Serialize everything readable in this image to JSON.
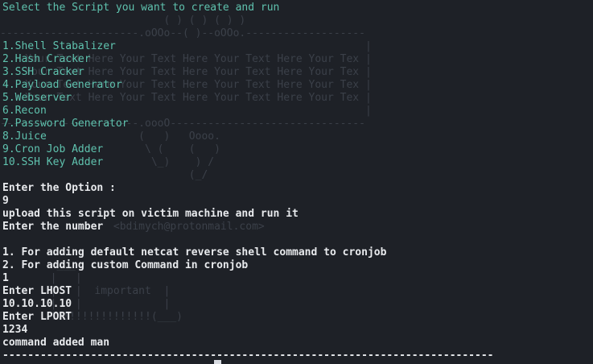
{
  "terminal": {
    "header": "Select the Script you want to create and run",
    "menu": [
      "1.Shell Stabalizer",
      "2.Hash Cracker",
      "3.SSH Cracker",
      "4.Payload Generator",
      "5.Webserver",
      "6.Recon",
      "7.Password Generator",
      "8.Juice",
      "9.Cron Job Adder",
      "10.SSH Key Adder"
    ],
    "output": [
      "Enter the Option :",
      "9",
      "upload this script on victim machine and run it",
      "Enter the number",
      "",
      "1. For adding default netcat reverse shell command to cronjob",
      "2. For adding custom Command in cronjob",
      "1",
      "Enter LHOST",
      "10.10.10.10",
      "Enter LPORT",
      "1234",
      "command added man",
      "------------------------------------------------------------------------------"
    ]
  },
  "background_art": {
    "top": "                          ( ) ( ) ( ) )\n----------------------.oOOo--( )--oOOo.-------------------\n                                                          |\n    Your Text Here Your Text Here Your Text Here Your Tex |\n    Your Text Here Your Text Here Your Text Here Your Tex |\n    Your Text Here Your Text Here Your Text Here Your Tex |\n    Your Text Here Your Text Here Your Text Here Your Tex |\n                                                          |\n----------------------.oooO-------------------------------\n                      (   )   Oooo.\n                       \\ (    (   )\n                        \\_)    ) /\n                              (_/",
    "middle": "                  <bdimych@protonmail.com>",
    "bottom": "         ___\n        |   |\n        |   |  important  |\n        |   |             |\n        !!!!!!!!!!!!!!!!(___)"
  }
}
